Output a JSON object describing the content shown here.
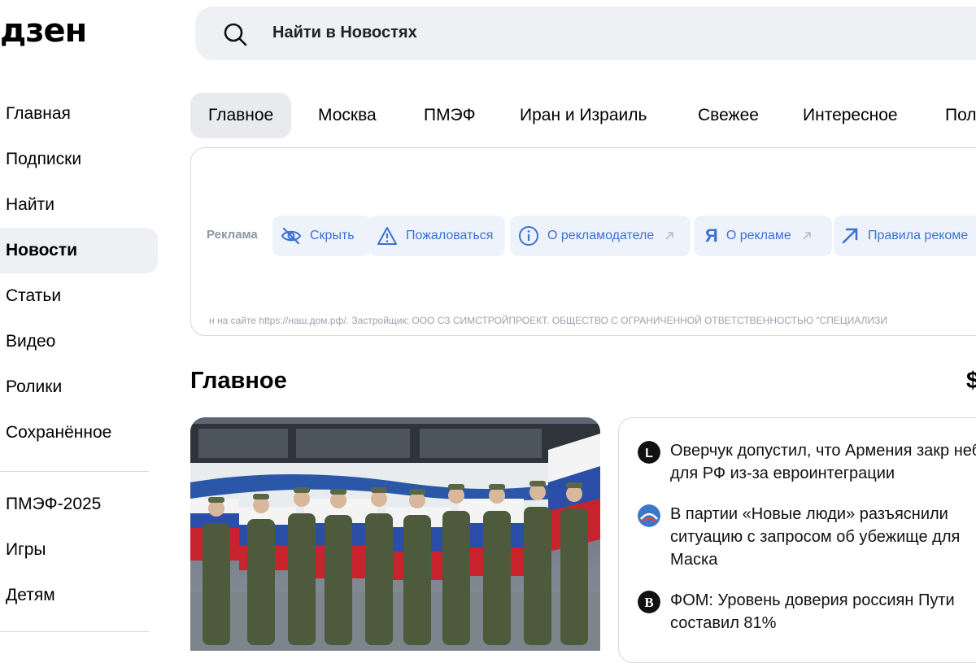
{
  "logo": {
    "text": "дзен"
  },
  "search": {
    "placeholder": "Найти в Новостях"
  },
  "sidebar": {
    "items": [
      {
        "label": "Главная"
      },
      {
        "label": "Подписки"
      },
      {
        "label": "Найти"
      },
      {
        "label": "Новости",
        "active": true
      },
      {
        "label": "Статьи"
      },
      {
        "label": "Видео"
      },
      {
        "label": "Ролики"
      },
      {
        "label": "Сохранённое"
      }
    ],
    "items2": [
      {
        "label": "ПМЭФ-2025"
      },
      {
        "label": "Игры"
      },
      {
        "label": "Детям"
      }
    ]
  },
  "tabs": [
    {
      "label": "Главное",
      "active": true
    },
    {
      "label": "Москва"
    },
    {
      "label": "ПМЭФ"
    },
    {
      "label": "Иран и Израиль"
    },
    {
      "label": "Свежее"
    },
    {
      "label": "Интересное"
    },
    {
      "label": "Пол"
    }
  ],
  "ad": {
    "label": "Реклама",
    "hide": "Скрыть",
    "complain": "Пожаловаться",
    "advertiser": "О рекламодателе",
    "about": "О рекламе",
    "rules": "Правила рекоме",
    "disclaimer": "н на сайте https://наш.дом.рф/. Застройщик: ООО СЗ СИМСТРОЙПРОЕКТ. ОБЩЕСТВО С ОГРАНИЧЕННОЙ ОТВЕТСТВЕННОСТЬЮ \"СПЕЦИАЛИЗИ"
  },
  "main": {
    "section_title": "Главное",
    "section_right": "$"
  },
  "news": [
    {
      "text": "Оверчук допустил, что Армения закр небо для РФ из-за евроинтеграции",
      "icon": "lenta-icon"
    },
    {
      "text": "В партии «Новые люди» разъяснили ситуацию с запросом об убежище для Маска",
      "icon": "partiya-icon"
    },
    {
      "text": "ФОМ: Уровень доверия россиян Пути составил 81%",
      "icon": "vedomosti-icon"
    }
  ],
  "colors": {
    "accent": "#3d6fd6",
    "surface": "#eef0f3"
  }
}
